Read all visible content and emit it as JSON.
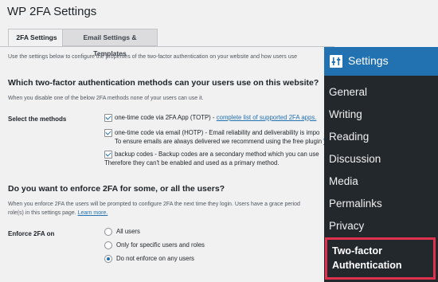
{
  "page": {
    "title": "WP 2FA Settings",
    "tabs": [
      {
        "label": "2FA Settings",
        "active": true
      },
      {
        "label": "Email Settings & Templates",
        "active": false
      }
    ],
    "intro": "Use the settings below to configure the properties of the two-factor authentication on your website and how users use"
  },
  "methods_section": {
    "heading": "Which two-factor authentication methods can your users use on this website?",
    "desc": "When you disable one of the below 2FA methods none of your users can use it.",
    "row_label": "Select the methods",
    "options": [
      {
        "text": "one-time code via 2FA App (TOTP) - ",
        "link": "complete list of supported 2FA apps.",
        "checked": true
      },
      {
        "text": "one-time code via email (HOTP) - Email reliability and deliverability is impo",
        "line2": "To ensure emails are always delivered we recommend using the free plugin ",
        "line2_link": "W",
        "checked": true
      },
      {
        "text": "backup codes - Backup codes are a secondary method which you can use",
        "line2": "Therefore they can't be enabled and used as a primary method.",
        "checked": true
      }
    ]
  },
  "enforce_section": {
    "heading": "Do you want to enforce 2FA for some, or all the users?",
    "desc_line1": "When you enforce 2FA the users will be prompted to configure 2FA the next time they login. Users have a grace period",
    "desc_line2": "role(s) in this settings page. ",
    "desc_link": "Learn more.",
    "row_label": "Enforce 2FA on",
    "options": [
      {
        "label": "All users",
        "selected": false
      },
      {
        "label": "Only for specific users and roles",
        "selected": false
      },
      {
        "label": "Do not enforce on any users",
        "selected": true
      }
    ]
  },
  "sidebar": {
    "header": "Settings",
    "header_icon": "settings-sliders-icon",
    "items": [
      "General",
      "Writing",
      "Reading",
      "Discussion",
      "Media",
      "Permalinks",
      "Privacy"
    ],
    "active_line1": "Two-factor",
    "active_line2": "Authentication",
    "colors": {
      "bg": "#23282d",
      "header": "#2271b1",
      "highlight": "#e0314f"
    }
  }
}
